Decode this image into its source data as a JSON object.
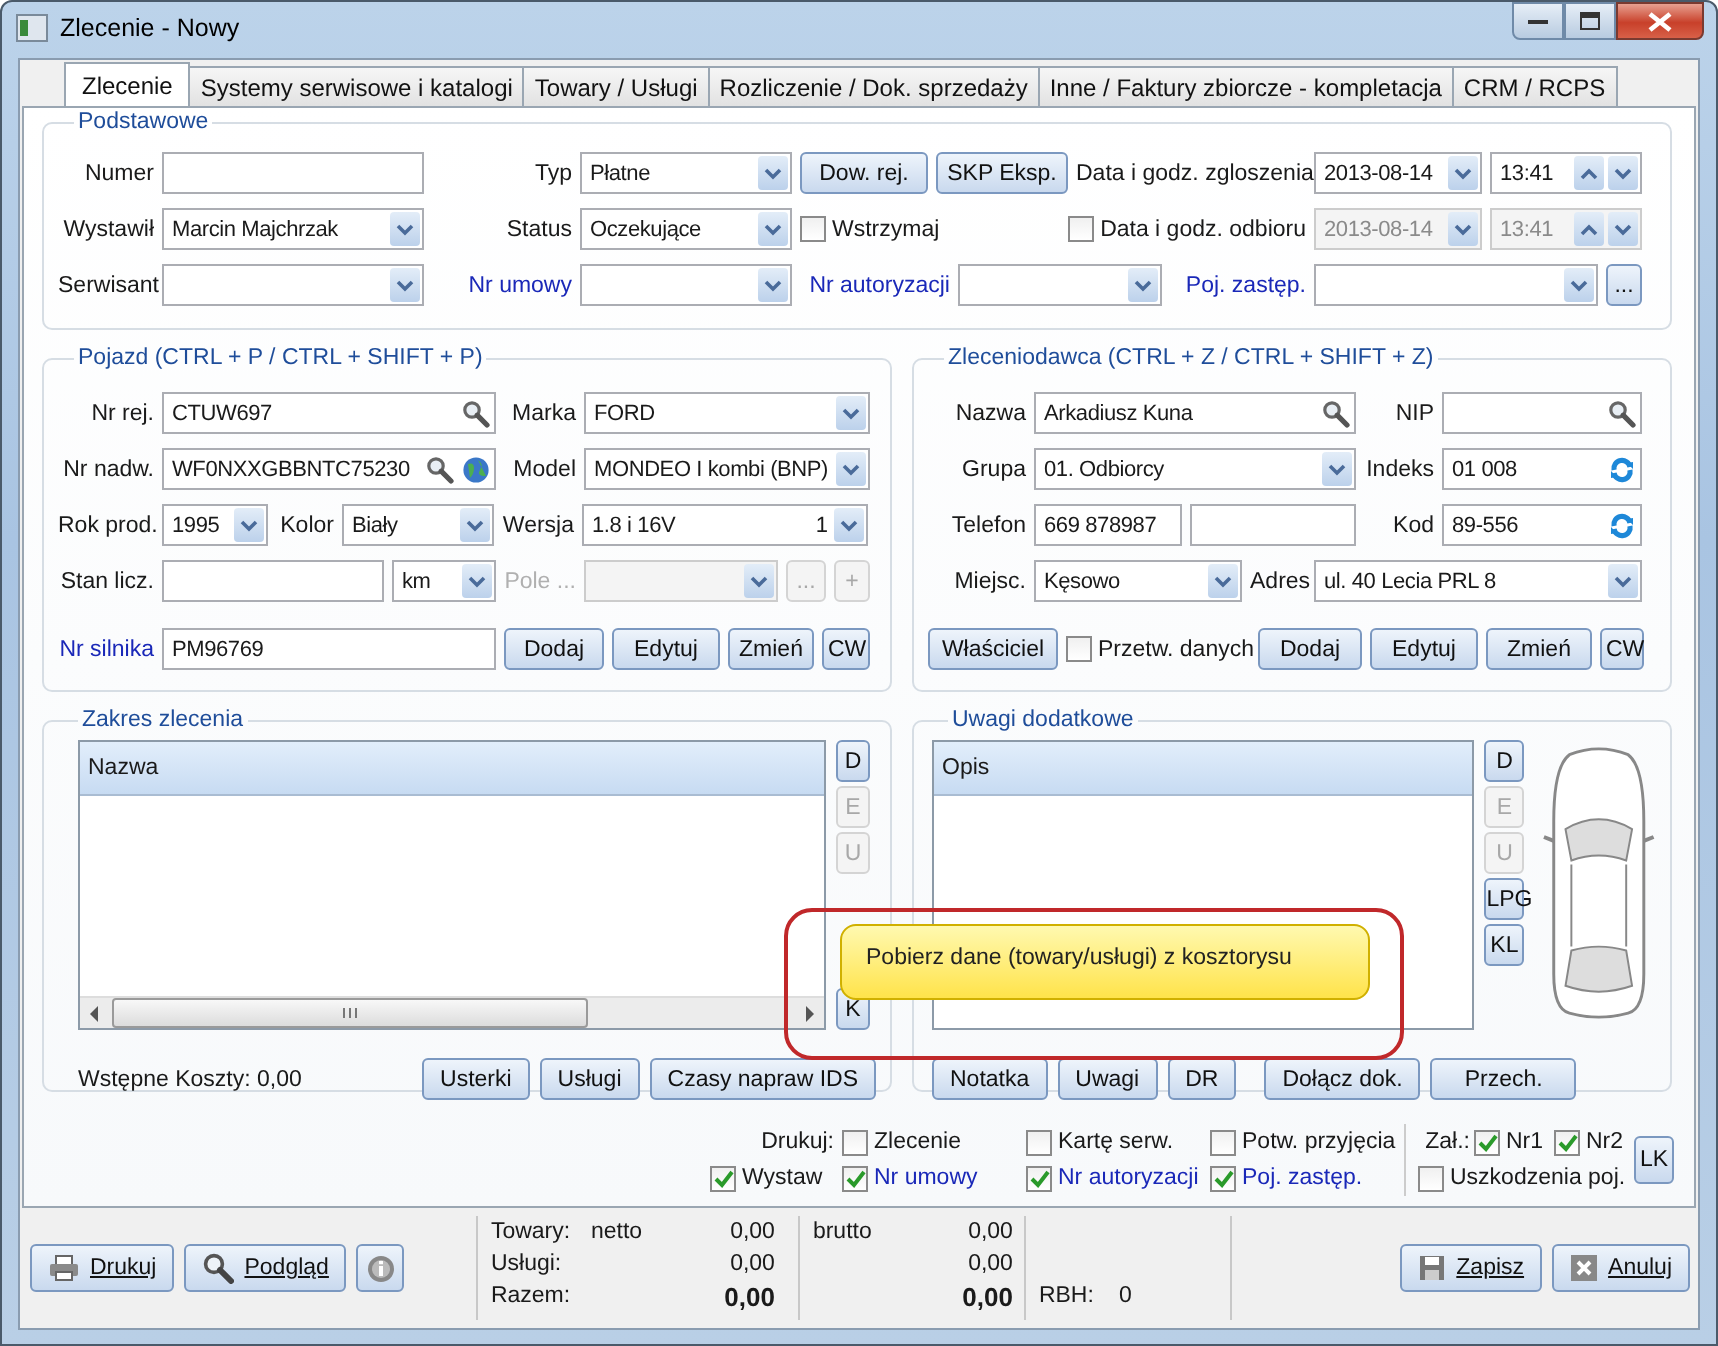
{
  "window": {
    "title": "Zlecenie - Nowy"
  },
  "tabs": [
    {
      "label": "Zlecenie",
      "selected": true
    },
    {
      "label": "Systemy serwisowe i katalogi",
      "selected": false
    },
    {
      "label": "Towary / Usługi",
      "selected": false
    },
    {
      "label": "Rozliczenie / Dok. sprzedaży",
      "selected": false
    },
    {
      "label": "Inne / Faktury zbiorcze - kompletacja",
      "selected": false
    },
    {
      "label": "CRM / RCPS",
      "selected": false
    }
  ],
  "basic": {
    "title": "Podstawowe",
    "rows": [
      {
        "items": [
          {
            "kind": "label",
            "text": "Numer",
            "link": false
          },
          {
            "kind": "text"
          },
          {
            "kind": "label",
            "text": "Typ",
            "link": false
          },
          {
            "kind": "combo",
            "value": "Płatne"
          },
          {
            "kind": "button",
            "text": "Dow. rej."
          },
          {
            "kind": "button",
            "text": "SKP Eksp."
          },
          {
            "kind": "label",
            "text": "Data i godz. zgloszenia",
            "link": false
          },
          {
            "kind": "date",
            "value": "2013-08-14",
            "disabled": false
          },
          {
            "kind": "time",
            "value": "13:41",
            "disabled": false
          }
        ]
      },
      {
        "items": [
          {
            "kind": "label",
            "text": "Wystawił",
            "link": false
          },
          {
            "kind": "combo",
            "value": "Marcin Majchrzak"
          },
          {
            "kind": "label",
            "text": "Status",
            "link": false
          },
          {
            "kind": "combo",
            "value": "Oczekujące"
          },
          {
            "kind": "check",
            "text": "Wstrzymaj",
            "checked": false
          },
          {
            "kind": "check",
            "text": "Data i godz. odbioru",
            "checked": false
          },
          {
            "kind": "date",
            "value": "2013-08-14",
            "disabled": true
          },
          {
            "kind": "time",
            "value": "13:41",
            "disabled": true
          }
        ]
      },
      {
        "items": [
          {
            "kind": "label",
            "text": "Serwisant",
            "link": false
          },
          {
            "kind": "combo"
          },
          {
            "kind": "label",
            "text": "Nr umowy",
            "link": true
          },
          {
            "kind": "combo"
          },
          {
            "kind": "label",
            "text": "Nr autoryzacji",
            "link": true
          },
          {
            "kind": "combo"
          },
          {
            "kind": "label",
            "text": "Poj. zastęp.",
            "link": true
          },
          {
            "kind": "combo"
          },
          {
            "kind": "button",
            "text": "..."
          }
        ]
      }
    ]
  },
  "vehicle": {
    "title": "Pojazd (CTRL + P / CTRL + SHIFT + P)",
    "rows": [
      {
        "items": [
          {
            "kind": "label",
            "text": "Nr rej.",
            "link": false
          },
          {
            "kind": "search",
            "value": "CTUW697"
          },
          {
            "kind": "label",
            "text": "Marka",
            "link": false
          },
          {
            "kind": "combo",
            "value": "FORD"
          }
        ]
      },
      {
        "items": [
          {
            "kind": "label",
            "text": "Nr nadw.",
            "link": false
          },
          {
            "kind": "search-web",
            "value": "WF0NXXGBBNTC75230"
          },
          {
            "kind": "label",
            "text": "Model",
            "link": false
          },
          {
            "kind": "combo",
            "value": "MONDEO I kombi (BNP)"
          }
        ]
      },
      {
        "items": [
          {
            "kind": "label",
            "text": "Rok prod.",
            "link": false
          },
          {
            "kind": "combo",
            "value": "1995"
          },
          {
            "kind": "label",
            "text": "Kolor",
            "link": false
          },
          {
            "kind": "combo",
            "value": "Biały"
          },
          {
            "kind": "label",
            "text": "Wersja",
            "link": false
          },
          {
            "kind": "combo",
            "value": "1.8 i 16V",
            "extra": "1"
          }
        ]
      },
      {
        "items": [
          {
            "kind": "label",
            "text": "Stan licz.",
            "link": false
          },
          {
            "kind": "text"
          },
          {
            "kind": "combo",
            "value": "km"
          },
          {
            "kind": "label",
            "text": "Pole ...",
            "link": false,
            "disabled": true
          },
          {
            "kind": "combo",
            "disabled": true
          },
          {
            "kind": "button",
            "text": "...",
            "disabled": true
          },
          {
            "kind": "button",
            "text": "+",
            "disabled": true
          }
        ]
      },
      {
        "items": [
          {
            "kind": "label",
            "text": "Nr silnika",
            "link": true
          },
          {
            "kind": "text",
            "value": "PM96769"
          },
          {
            "kind": "button",
            "text": "Dodaj"
          },
          {
            "kind": "button",
            "text": "Edytuj"
          },
          {
            "kind": "button",
            "text": "Zmień"
          },
          {
            "kind": "button",
            "text": "CW"
          }
        ]
      }
    ]
  },
  "client": {
    "title": "Zleceniodawca (CTRL + Z / CTRL + SHIFT + Z)",
    "rows": [
      {
        "items": [
          {
            "kind": "label",
            "text": "Nazwa",
            "link": false
          },
          {
            "kind": "search",
            "value": "Arkadiusz Kuna"
          },
          {
            "kind": "label",
            "text": "NIP",
            "link": false
          },
          {
            "kind": "search"
          }
        ]
      },
      {
        "items": [
          {
            "kind": "label",
            "text": "Grupa",
            "link": false
          },
          {
            "kind": "combo",
            "value": "01. Odbiorcy"
          },
          {
            "kind": "label",
            "text": "Indeks",
            "link": false
          },
          {
            "kind": "refresh",
            "value": "01 008"
          }
        ]
      },
      {
        "items": [
          {
            "kind": "label",
            "text": "Telefon",
            "link": false
          },
          {
            "kind": "text",
            "value": "669 878987"
          },
          {
            "kind": "text"
          },
          {
            "kind": "label",
            "text": "Kod",
            "link": false
          },
          {
            "kind": "refresh",
            "value": "89-556"
          }
        ]
      },
      {
        "items": [
          {
            "kind": "label",
            "text": "Miejsc.",
            "link": false
          },
          {
            "kind": "combo",
            "value": "Kęsowo"
          },
          {
            "kind": "label",
            "text": "Adres",
            "link": false
          },
          {
            "kind": "combo",
            "value": "ul. 40 Lecia PRL 8"
          }
        ]
      },
      {
        "items": [
          {
            "kind": "button",
            "text": "Właściciel"
          },
          {
            "kind": "check",
            "text": "Przetw. danych",
            "checked": false
          },
          {
            "kind": "button",
            "text": "Dodaj"
          },
          {
            "kind": "button",
            "text": "Edytuj"
          },
          {
            "kind": "button",
            "text": "Zmień"
          },
          {
            "kind": "button",
            "text": "CW"
          }
        ]
      }
    ]
  },
  "scope": {
    "title": "Zakres zlecenia",
    "column": "Nazwa",
    "side_buttons": [
      {
        "text": "D",
        "disabled": false
      },
      {
        "text": "E",
        "disabled": true
      },
      {
        "text": "U",
        "disabled": true
      },
      {
        "text": "K",
        "disabled": false
      }
    ],
    "costs": "Wstępne Koszty: 0,00",
    "buttons": [
      "Usterki",
      "Usługi",
      "Czasy napraw IDS"
    ],
    "tooltip": "Pobierz dane (towary/usługi) z kosztorysu"
  },
  "notes": {
    "title": "Uwagi dodatkowe",
    "column": "Opis",
    "side_buttons": [
      {
        "text": "D",
        "disabled": false
      },
      {
        "text": "E",
        "disabled": true
      },
      {
        "text": "U",
        "disabled": true
      },
      {
        "text": "LPG",
        "disabled": false
      },
      {
        "text": "KL",
        "disabled": false
      }
    ],
    "buttons": [
      "Notatka",
      "Uwagi",
      "DR",
      "Dołącz dok.",
      "Przech."
    ]
  },
  "print": {
    "label": "Drukuj:",
    "options": [
      {
        "text": "Zlecenie",
        "checked": false,
        "link": false
      },
      {
        "text": "Kartę serw.",
        "checked": false,
        "link": false
      },
      {
        "text": "Potw. przyjęcia",
        "checked": false,
        "link": false
      },
      {
        "text": "Wystaw",
        "checked": true,
        "link": false
      },
      {
        "text": "Nr umowy",
        "checked": true,
        "link": true
      },
      {
        "text": "Nr autoryzacji",
        "checked": true,
        "link": true
      },
      {
        "text": "Poj. zastęp.",
        "checked": true,
        "link": true
      }
    ],
    "attach_label": "Zał.:",
    "attachments": [
      {
        "text": "Nr1",
        "checked": true
      },
      {
        "text": "Nr2",
        "checked": true
      },
      {
        "text": "Uszkodzenia poj.",
        "checked": false
      }
    ],
    "button": "LK"
  },
  "footer": {
    "left_buttons": [
      "Drukuj",
      "Podgląd"
    ],
    "right_buttons": [
      "Zapisz",
      "Anuluj"
    ]
  },
  "totals": {
    "rows": [
      {
        "label": "Towary:",
        "net_label": "netto",
        "net": "0,00",
        "gross_label": "brutto",
        "gross": "0,00",
        "bold": false
      },
      {
        "label": "Usługi:",
        "net": "0,00",
        "gross": "0,00",
        "bold": false
      },
      {
        "label": "Razem:",
        "net": "0,00",
        "gross": "0,00",
        "bold": true
      }
    ],
    "rbh_label": "RBH:",
    "rbh": "0"
  }
}
